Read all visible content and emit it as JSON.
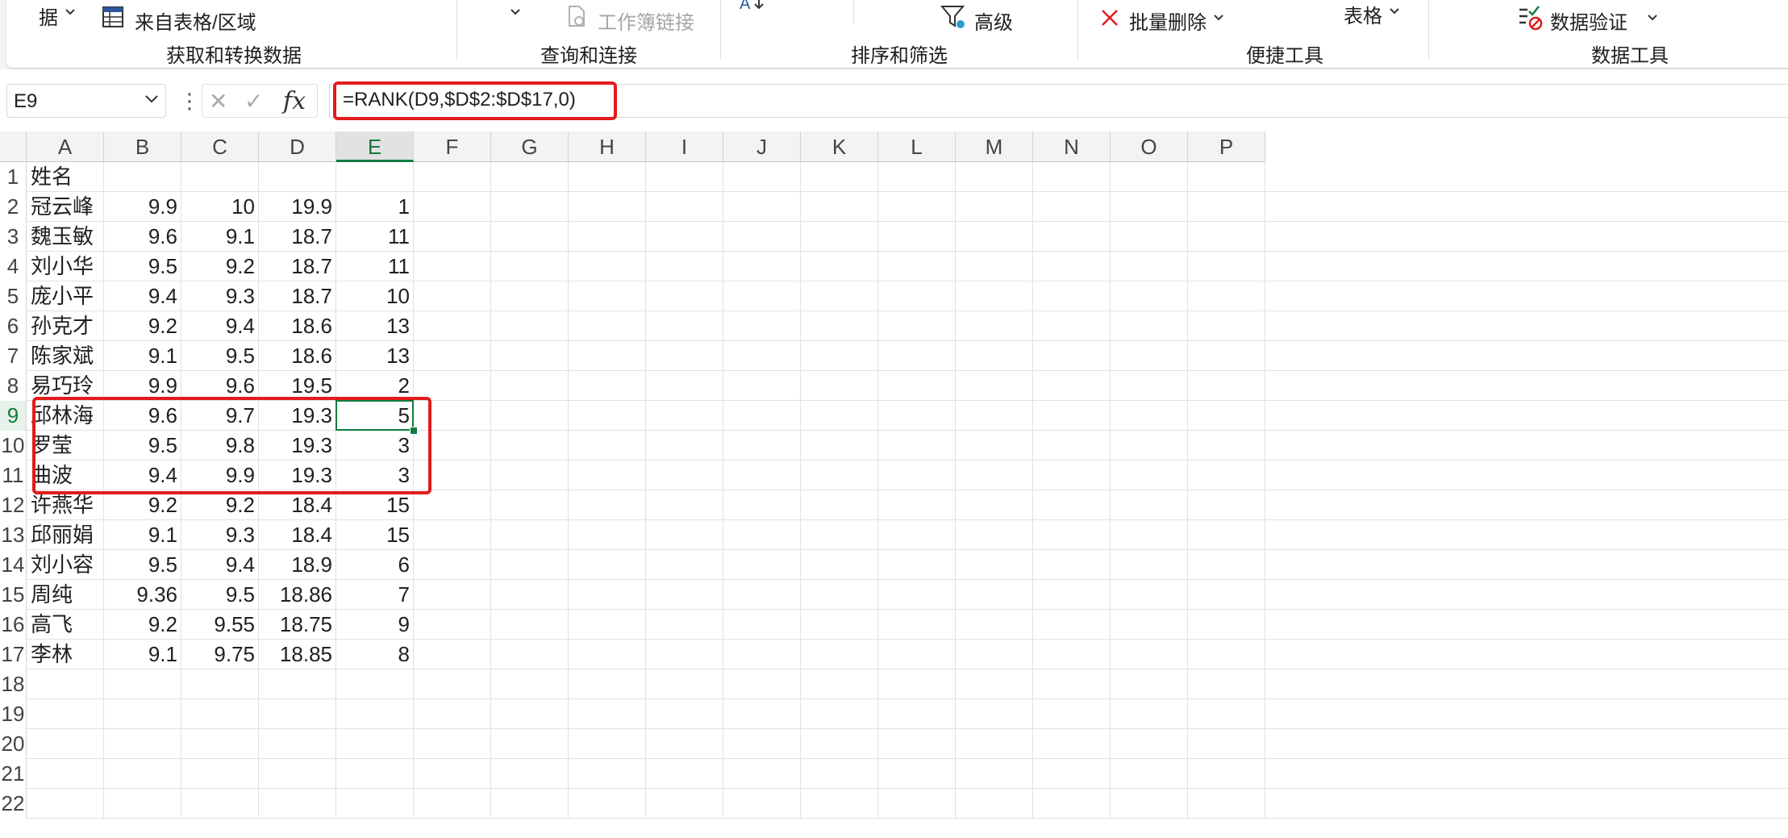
{
  "ribbon": {
    "groups": [
      {
        "label": "获取和转换数据"
      },
      {
        "label": "查询和连接"
      },
      {
        "label": "排序和筛选"
      },
      {
        "label": "便捷工具"
      },
      {
        "label": "数据工具"
      }
    ],
    "get_data_partial": "据",
    "from_table": "来自表格/区域",
    "workbook_links": "工作簿链接",
    "sort_partial": "A",
    "advanced": "高级",
    "batch_delete": "批量删除",
    "table": "表格",
    "data_validation": "数据验证"
  },
  "formula_bar": {
    "name_box": "E9",
    "cancel_glyph": "✕",
    "enter_glyph": "✓",
    "fx": "fx",
    "formula": "=RANK(D9,$D$2:$D$17,0)"
  },
  "sheet": {
    "columns": [
      "A",
      "B",
      "C",
      "D",
      "E",
      "F",
      "G",
      "H",
      "I",
      "J",
      "K",
      "L",
      "M",
      "N",
      "O",
      "P"
    ],
    "selected_cell": "E9",
    "highlighted_rows": [
      9,
      11
    ],
    "rows": [
      {
        "n": "1",
        "a": "姓名",
        "b": "",
        "c": "",
        "d": "",
        "e": ""
      },
      {
        "n": "2",
        "a": "冠云峰",
        "b": "9.9",
        "c": "10",
        "d": "19.9",
        "e": "1"
      },
      {
        "n": "3",
        "a": "魏玉敏",
        "b": "9.6",
        "c": "9.1",
        "d": "18.7",
        "e": "11"
      },
      {
        "n": "4",
        "a": "刘小华",
        "b": "9.5",
        "c": "9.2",
        "d": "18.7",
        "e": "11"
      },
      {
        "n": "5",
        "a": "庞小平",
        "b": "9.4",
        "c": "9.3",
        "d": "18.7",
        "e": "10"
      },
      {
        "n": "6",
        "a": "孙克才",
        "b": "9.2",
        "c": "9.4",
        "d": "18.6",
        "e": "13"
      },
      {
        "n": "7",
        "a": "陈家斌",
        "b": "9.1",
        "c": "9.5",
        "d": "18.6",
        "e": "13"
      },
      {
        "n": "8",
        "a": "易巧玲",
        "b": "9.9",
        "c": "9.6",
        "d": "19.5",
        "e": "2"
      },
      {
        "n": "9",
        "a": "邱林海",
        "b": "9.6",
        "c": "9.7",
        "d": "19.3",
        "e": "5"
      },
      {
        "n": "10",
        "a": "罗莹",
        "b": "9.5",
        "c": "9.8",
        "d": "19.3",
        "e": "3"
      },
      {
        "n": "11",
        "a": "曲波",
        "b": "9.4",
        "c": "9.9",
        "d": "19.3",
        "e": "3"
      },
      {
        "n": "12",
        "a": "许燕华",
        "b": "9.2",
        "c": "9.2",
        "d": "18.4",
        "e": "15"
      },
      {
        "n": "13",
        "a": "邱丽娟",
        "b": "9.1",
        "c": "9.3",
        "d": "18.4",
        "e": "15"
      },
      {
        "n": "14",
        "a": "刘小容",
        "b": "9.5",
        "c": "9.4",
        "d": "18.9",
        "e": "6"
      },
      {
        "n": "15",
        "a": "周纯",
        "b": "9.36",
        "c": "9.5",
        "d": "18.86",
        "e": "7"
      },
      {
        "n": "16",
        "a": "高飞",
        "b": "9.2",
        "c": "9.55",
        "d": "18.75",
        "e": "9"
      },
      {
        "n": "17",
        "a": "李林",
        "b": "9.1",
        "c": "9.75",
        "d": "18.85",
        "e": "8"
      },
      {
        "n": "18",
        "a": "",
        "b": "",
        "c": "",
        "d": "",
        "e": ""
      },
      {
        "n": "19",
        "a": "",
        "b": "",
        "c": "",
        "d": "",
        "e": ""
      },
      {
        "n": "20",
        "a": "",
        "b": "",
        "c": "",
        "d": "",
        "e": ""
      },
      {
        "n": "21",
        "a": "",
        "b": "",
        "c": "",
        "d": "",
        "e": ""
      },
      {
        "n": "22",
        "a": "",
        "b": "",
        "c": "",
        "d": "",
        "e": ""
      }
    ]
  },
  "colors": {
    "accent_green": "#107c41",
    "highlight_red": "#e21b1b"
  }
}
